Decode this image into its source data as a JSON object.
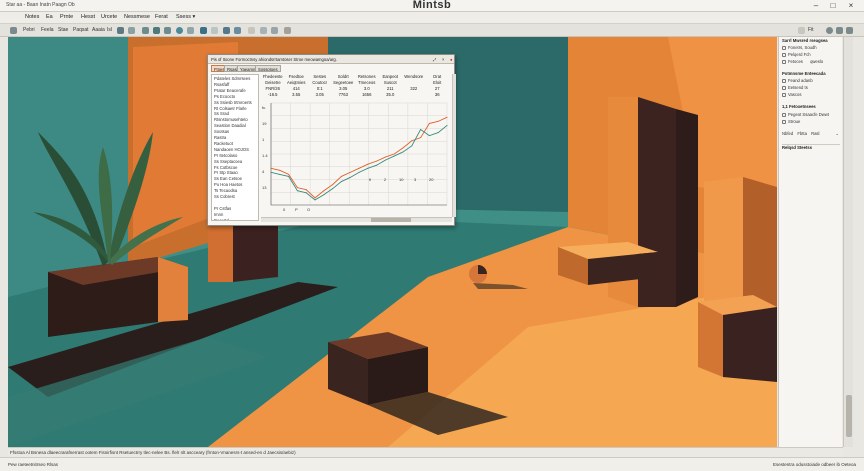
{
  "app": {
    "title": "Mintsb",
    "window_left": "Star aa - Baan Inatn Paagn Ob"
  },
  "menu": [
    "Notes",
    "Ea",
    "Prnte",
    "Hesst",
    "Urcete",
    "Nessmese",
    "Ferat",
    "Ssess ▾"
  ],
  "toolbar": {
    "labels": [
      "Pebri",
      "Feela",
      "Stae",
      "Paqsat",
      "Aaaia",
      "Isl"
    ]
  },
  "colors": {
    "teal": "#3f8f86",
    "teal_dark": "#255d5a",
    "orange": "#e88a3c",
    "orange_light": "#f2a050",
    "brown": "#3a2420",
    "leaf": "#2f5a3d"
  },
  "panel": {
    "section1_header": "Sarrl Mwsred rseagsea",
    "section1_items": [
      "Fonetrs, Soudh",
      "Pelqerd Fch",
      "Fetoces"
    ],
    "section1_side": "qweslo",
    "section2_header": "Potmnsme Enteecada",
    "section2_items": [
      "Feand adanb",
      "Eetsend ts",
      "Vascos"
    ],
    "section3_header": "1,1 Fetoxetnsees",
    "section3_items": [
      "Pegeot Ssaacfe Dwwt",
      "Stroue"
    ],
    "section3_buttons": [
      "Nbfed",
      "Fbtta",
      "Rasl"
    ],
    "section4_header": "Relqsd Steetss"
  },
  "dialog": {
    "title": "Pis of Itoone   Formoctnsy ahiondsrrtamtoser Stroe meowamgoa/arg.",
    "tabs": [
      "Ftnes",
      "Rsasie",
      "Yaeamns",
      "Sossotoes"
    ],
    "list": [
      "Pdateles Sdmrsees",
      "Rsasfaff",
      "Pratar Eeacerafe",
      "Ps Ecoocto",
      "Ss Ssiesb trtmroerts",
      "Rt Colsaetr Flarle",
      "Ss Srad",
      "Rtsnstomusehteto",
      "Seastion Daadial",
      "Sootsas",
      "Rastra",
      "Racketuot",
      "Nandaoen HOJOS",
      "Pr Itetcolaso",
      "Ss Sseptacoea",
      "Fs Cotbscoe",
      "Pr Stp Staao",
      "Ss Ean Cetsoe",
      "Pu Hoa Haetos",
      "Ts Tecaodsa",
      "Ss Cobrest",
      "Pr Cstfas",
      "Imnn",
      "Decertd"
    ],
    "col_headers": [
      "Fhedeeste",
      "Fsedtoe",
      "Sestes",
      "Soldrt",
      "Retsones",
      "Eanpeot",
      "Wendsore",
      "Drat"
    ],
    "row2": [
      "Geisetre",
      "Aeiqtmies",
      "Coutocr",
      "Segeetoee",
      "Tmeceos",
      "Suscot",
      "",
      "Eloit"
    ],
    "row3": [
      "FNR/26",
      "414",
      "0:1",
      "3.05",
      "3.0",
      "211",
      "322",
      "27"
    ],
    "row4": [
      "-16.5",
      "3.55",
      "3.05",
      "7763",
      "1656",
      "35.0",
      "",
      "36"
    ],
    "axis_x_labels": [
      "0",
      "P",
      "O"
    ],
    "axis_x_labels2": [
      "fl",
      "2",
      "10",
      "3",
      "20"
    ],
    "axis_y_labels": [
      "fu",
      "19",
      "1",
      "1.4",
      "4",
      "13"
    ]
  },
  "hscroll": "Ffsstoa Al Bsnesa dlaeecrarafnerrast ootem Fisnirfisnt Rsetuectrry tlec-nelee Bs. flelr nlt ascceary (frnton-Vnanesrs-t ansed-en d Jaecsis/aebiz)",
  "status": {
    "left": "Pew raeteetnitrseo Rlsas",
    "right": "Esestentra odusstoiade odbeer ib Oeteoa"
  },
  "chart_data": {
    "type": "line",
    "series": [
      {
        "values": [
          66,
          64,
          60,
          47,
          45,
          37,
          44,
          50,
          58,
          62,
          66,
          70,
          73,
          77,
          80,
          86,
          93,
          96,
          110,
          112,
          116
        ]
      },
      {
        "values": [
          62,
          60,
          58,
          44,
          42,
          35,
          40,
          46,
          53,
          57,
          62,
          66,
          69,
          74,
          78,
          82,
          88,
          104,
          98,
          101,
          108
        ]
      }
    ],
    "ylim": [
      30,
      130
    ]
  }
}
